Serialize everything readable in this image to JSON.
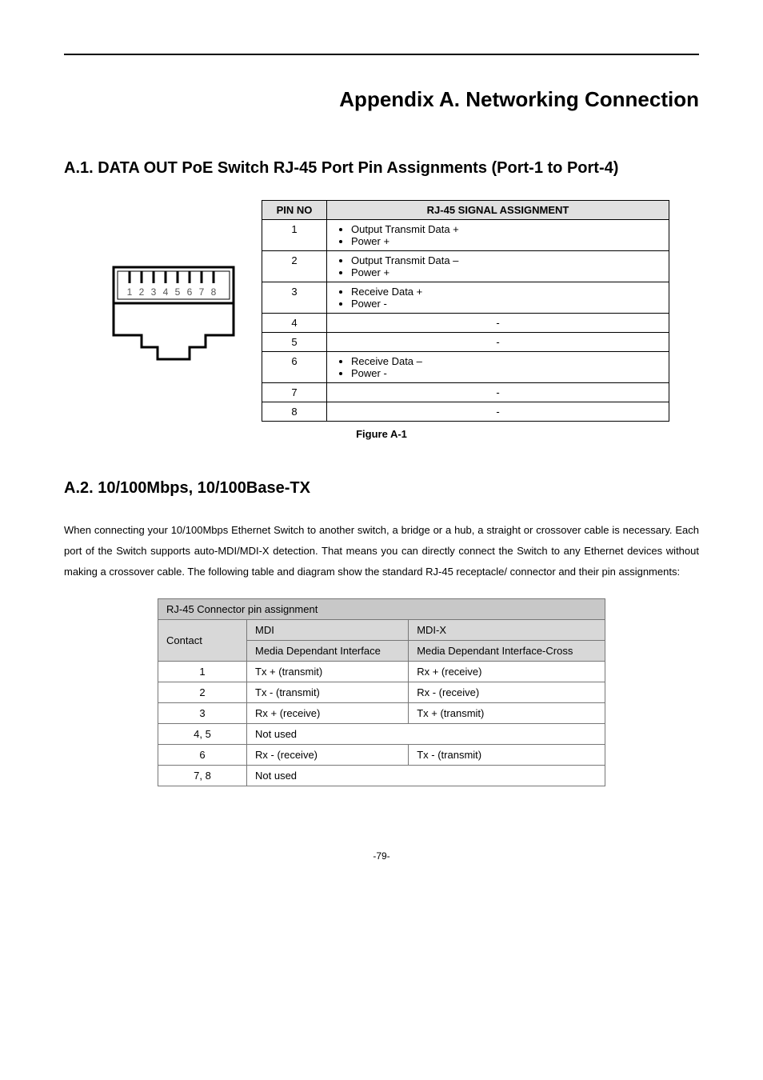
{
  "appendix_title": "Appendix A. Networking Connection",
  "section_a1": {
    "title": "A.1. DATA OUT PoE Switch RJ-45 Port Pin Assignments (Port-1 to Port-4)",
    "headers": {
      "pinno": "PIN NO",
      "signal": "RJ-45 SIGNAL ASSIGNMENT"
    },
    "rows": [
      {
        "pin": "1",
        "items": [
          "Output Transmit Data +",
          "Power +"
        ]
      },
      {
        "pin": "2",
        "items": [
          "Output Transmit Data –",
          "Power +"
        ]
      },
      {
        "pin": "3",
        "items": [
          "Receive Data +",
          "Power -"
        ]
      },
      {
        "pin": "4",
        "dash": "-"
      },
      {
        "pin": "5",
        "dash": "-"
      },
      {
        "pin": "6",
        "items": [
          "Receive Data –",
          "Power -"
        ]
      },
      {
        "pin": "7",
        "dash": "-"
      },
      {
        "pin": "8",
        "dash": "-"
      }
    ],
    "figure_caption": "Figure A-1",
    "connector_labels": [
      "1",
      "2",
      "3",
      "4",
      "5",
      "6",
      "7",
      "8"
    ]
  },
  "section_a2": {
    "title": "A.2. 10/100Mbps, 10/100Base-TX",
    "paragraph": "When connecting your 10/100Mbps Ethernet Switch to another switch, a bridge or a hub, a straight or crossover cable is necessary. Each port of the Switch supports auto-MDI/MDI-X detection. That means you can directly connect the Switch to any Ethernet devices without making a crossover cable. The following table and diagram show the standard RJ-45 receptacle/ connector and their pin assignments:",
    "table": {
      "caption": "RJ-45 Connector pin assignment",
      "contact_label": "Contact",
      "mdi_label": "MDI",
      "mdi_sub": "Media Dependant Interface",
      "mdix_label": "MDI-X",
      "mdix_sub": "Media Dependant Interface-Cross",
      "rows": [
        {
          "c": "1",
          "m": "Tx + (transmit)",
          "x": "Rx + (receive)"
        },
        {
          "c": "2",
          "m": "Tx - (transmit)",
          "x": "Rx - (receive)"
        },
        {
          "c": "3",
          "m": "Rx + (receive)",
          "x": "Tx + (transmit)"
        },
        {
          "c": "4, 5",
          "merged": "Not used"
        },
        {
          "c": "6",
          "m": "Rx - (receive)",
          "x": "Tx - (transmit)"
        },
        {
          "c": "7, 8",
          "merged": "Not used"
        }
      ]
    }
  },
  "page_number": "-79-"
}
